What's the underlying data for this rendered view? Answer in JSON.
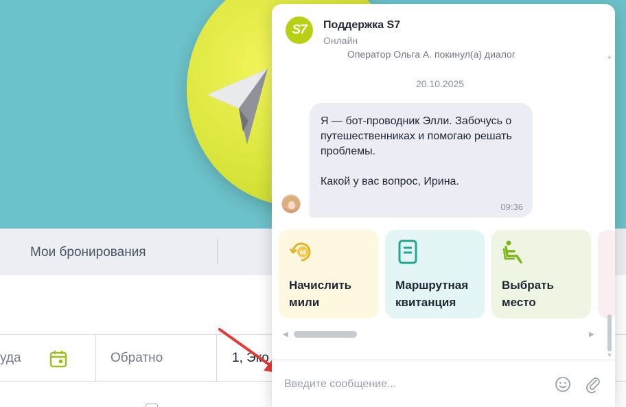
{
  "background": {
    "tabs": {
      "bookings_label": "Мои бронирования"
    },
    "search": {
      "from_text": "уда",
      "back_placeholder": "Обратно",
      "passengers_text": "1, Эко"
    }
  },
  "chat": {
    "header": {
      "logo_text": "S7",
      "title": "Поддержка S7",
      "status": "Онлайн"
    },
    "system_message": "Оператор Ольга А. покинул(а) диалог",
    "date": "20.10.2025",
    "message": {
      "line1": "Я — бот-проводник Элли. Забочусь о путешественниках и помогаю решать проблемы.",
      "line2": "Какой у вас вопрос, Ирина.",
      "time": "09:36"
    },
    "quick_actions": [
      {
        "label": "Начислить мили",
        "icon": "miles-coin-icon"
      },
      {
        "label": "Маршрутная квитанция",
        "icon": "receipt-icon"
      },
      {
        "label": "Выбрать место",
        "icon": "seat-icon"
      }
    ],
    "input": {
      "placeholder": "Введите сообщение..."
    }
  },
  "colors": {
    "brand_green": "#b7d014",
    "hero_bg": "#6cc2ca",
    "annotation_red": "#e53935"
  }
}
